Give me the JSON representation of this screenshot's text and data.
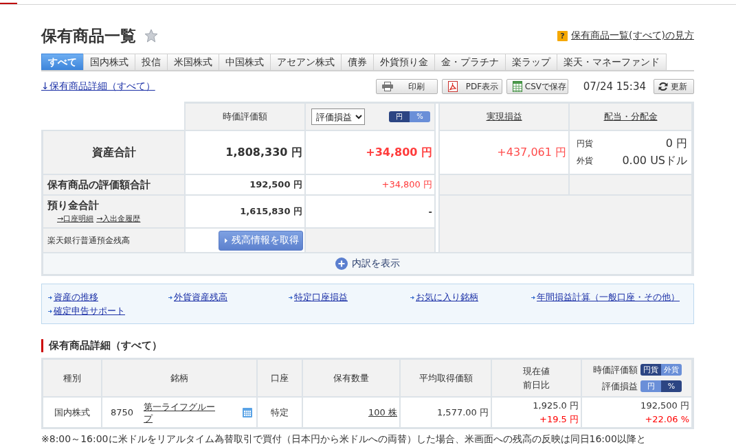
{
  "page": {
    "title": "保有商品一覧",
    "starred": false,
    "help_icon": "?",
    "help_link": "保有商品一覧(すべて)の見方"
  },
  "tabs": [
    {
      "label": "すべて",
      "selected": true
    },
    {
      "label": "国内株式",
      "selected": false
    },
    {
      "label": "投信",
      "selected": false
    },
    {
      "label": "米国株式",
      "selected": false
    },
    {
      "label": "中国株式",
      "selected": false
    },
    {
      "label": "アセアン株式",
      "selected": false
    },
    {
      "label": "債券",
      "selected": false
    },
    {
      "label": "外貨預り金",
      "selected": false
    },
    {
      "label": "金・プラチナ",
      "selected": false
    },
    {
      "label": "楽ラップ",
      "selected": false
    },
    {
      "label": "楽天・マネーファンド",
      "selected": false
    }
  ],
  "toolbar": {
    "detail_link": "↓保有商品詳細（すべて）",
    "buttons": [
      {
        "kind": "print",
        "label": "印刷"
      },
      {
        "kind": "pdf",
        "label": "PDF表示"
      },
      {
        "kind": "csv",
        "label": "CSVで保存"
      }
    ],
    "timestamp": "07/24 15:34",
    "refresh": "更新"
  },
  "summary": {
    "headers": {
      "market_value": "時価評価額",
      "pl_select": "評価損益",
      "pl_units": [
        {
          "label": "円",
          "selected": true
        },
        {
          "label": "%",
          "selected": false
        }
      ],
      "realized": "実現損益",
      "dividends": "配当・分配金"
    },
    "total": {
      "label": "資産合計",
      "market_value": "1,808,330 円",
      "pl": "+34,800 円",
      "realized": "+437,061 円",
      "dividends": [
        {
          "currency": "円貨",
          "amount": "0 円"
        },
        {
          "currency": "外貨",
          "amount": "0.00 USドル"
        }
      ]
    },
    "holdings": {
      "label": "保有商品の評価額合計",
      "market_value": "192,500 円",
      "pl": "+34,800 円"
    },
    "deposits": {
      "label": "預り金合計",
      "links": [
        "→口座明細",
        "→入出金履歴"
      ],
      "market_value": "1,615,830 円",
      "pl": "-"
    },
    "bank": {
      "label": "楽天銀行普通預金残高",
      "button": "残高情報を取得"
    },
    "breakdown": "内訳を表示"
  },
  "quick_links": [
    "資産の推移",
    "外貨資産残高",
    "特定口座損益",
    "お気に入り銘柄",
    "年間損益計算（一般口座・その他）",
    "確定申告サポート"
  ],
  "detail": {
    "title": "保有商品詳細（すべて）",
    "columns": [
      "種別",
      "銘柄",
      "口座",
      "保有数量",
      "平均取得価額"
    ],
    "price_column": [
      "現在値",
      "前日比"
    ],
    "value_column": [
      {
        "label": "時価評価額",
        "units": [
          {
            "label": "円貨",
            "selected": true
          },
          {
            "label": "外貨",
            "selected": false
          }
        ]
      },
      {
        "label": "評価損益",
        "units": [
          {
            "label": "円",
            "selected": false
          },
          {
            "label": "%",
            "selected": true
          }
        ]
      }
    ],
    "rows": [
      {
        "type": "国内株式",
        "code": "8750",
        "name": "第一ライフグループ",
        "account": "特定",
        "quantity": "100 株",
        "avg_cost": "1,577.00 円",
        "price": "1,925.0 円",
        "change": "+19.5 円",
        "market_value": "192,500 円",
        "pl": "+22.06 %"
      }
    ]
  },
  "note": "※8:00～16:00に米ドルをリアルタイム為替取引で買付（日本円から米ドルへの両替）した場合、米画面への残高の反映は同日16:00以降と"
}
